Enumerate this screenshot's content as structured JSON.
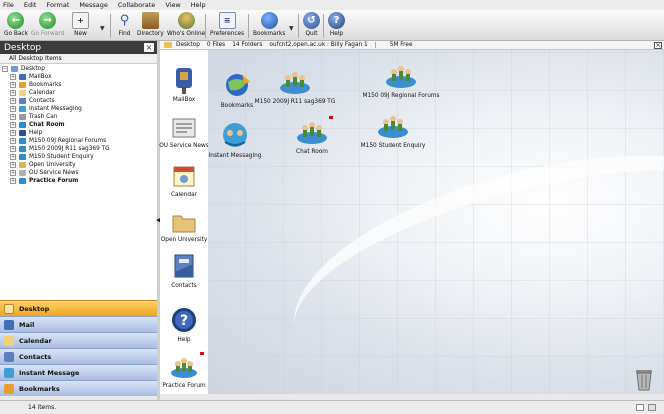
{
  "menu": [
    "File",
    "Edit",
    "Format",
    "Message",
    "Collaborate",
    "View",
    "Help"
  ],
  "toolbar": {
    "go_back": "Go Back",
    "go_forward": "Go Forward",
    "new": "New",
    "find": "Find",
    "directory": "Directory",
    "whos_online": "Who's Online",
    "preferences": "Preferences",
    "bookmarks": "Bookmarks",
    "quit": "Quit",
    "help": "Help"
  },
  "left_pane": {
    "title": "Desktop",
    "all_items": "All Desktop Items",
    "tree": [
      {
        "label": "Desktop",
        "bold": false
      },
      {
        "label": "MailBox",
        "bold": false
      },
      {
        "label": "Bookmarks",
        "bold": false
      },
      {
        "label": "Calendar",
        "bold": false
      },
      {
        "label": "Contacts",
        "bold": false
      },
      {
        "label": "Instant Messaging",
        "bold": false
      },
      {
        "label": "Trash Can",
        "bold": false
      },
      {
        "label": "Chat Room",
        "bold": true
      },
      {
        "label": "Help",
        "bold": false
      },
      {
        "label": "M150 09J Regional Forums",
        "bold": false
      },
      {
        "label": "M150 2009J R11 sag369 TG",
        "bold": false
      },
      {
        "label": "M150 Student Enquiry",
        "bold": false
      },
      {
        "label": "Open University",
        "bold": false
      },
      {
        "label": "OU Service News",
        "bold": false
      },
      {
        "label": "Practice Forum",
        "bold": true
      }
    ]
  },
  "nav": [
    "Desktop",
    "Mail",
    "Calendar",
    "Contacts",
    "Instant Message",
    "Bookmarks"
  ],
  "pathbar": {
    "location": "Desktop",
    "files": "0 Files",
    "folders": "14 Folders",
    "server": "oufcnt2.open.ac.uk : Billy Fagan 1",
    "free": "5M Free"
  },
  "desktop_icons": {
    "mailbox": "MailBox",
    "ou_news": "OU Service News",
    "calendar": "Calendar",
    "open_university": "Open University",
    "contacts": "Contacts",
    "help": "Help",
    "practice_forum": "Practice Forum",
    "bookmarks": "Bookmarks",
    "instant_messaging": "Instant Messaging",
    "m150_tg": "M150 2009J R11 sag369 TG",
    "chat_room": "Chat Room",
    "regional_forums": "M150 09J Regional Forums",
    "student_enquiry": "M150 Student Enquiry"
  },
  "status": "14 items."
}
